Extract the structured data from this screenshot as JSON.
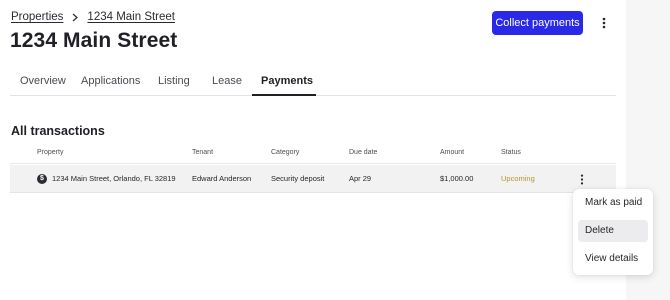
{
  "breadcrumb": {
    "parent": "Properties",
    "current": "1234 Main Street"
  },
  "header": {
    "title": "1234 Main Street",
    "collect_button": "Collect payments"
  },
  "tabs": [
    {
      "label": "Overview",
      "active": false
    },
    {
      "label": "Applications",
      "active": false
    },
    {
      "label": "Listing",
      "active": false
    },
    {
      "label": "Lease",
      "active": false
    },
    {
      "label": "Payments",
      "active": true
    }
  ],
  "transactions": {
    "title": "All transactions",
    "columns": [
      "Property",
      "Tenant",
      "Category",
      "Due date",
      "Amount",
      "Status"
    ],
    "rows": [
      {
        "icon": "dollar-icon",
        "property": "1234 Main Street, Orlando, FL 32819",
        "tenant": "Edward Anderson",
        "category": "Security deposit",
        "due_date": "Apr 29",
        "amount": "$1,000.00",
        "status": "Upcoming"
      }
    ]
  },
  "row_menu": {
    "items": [
      "Mark as paid",
      "Delete",
      "View details"
    ],
    "highlighted": "Delete"
  },
  "colors": {
    "primary": "#2929e6",
    "status_upcoming": "#b8962a"
  }
}
